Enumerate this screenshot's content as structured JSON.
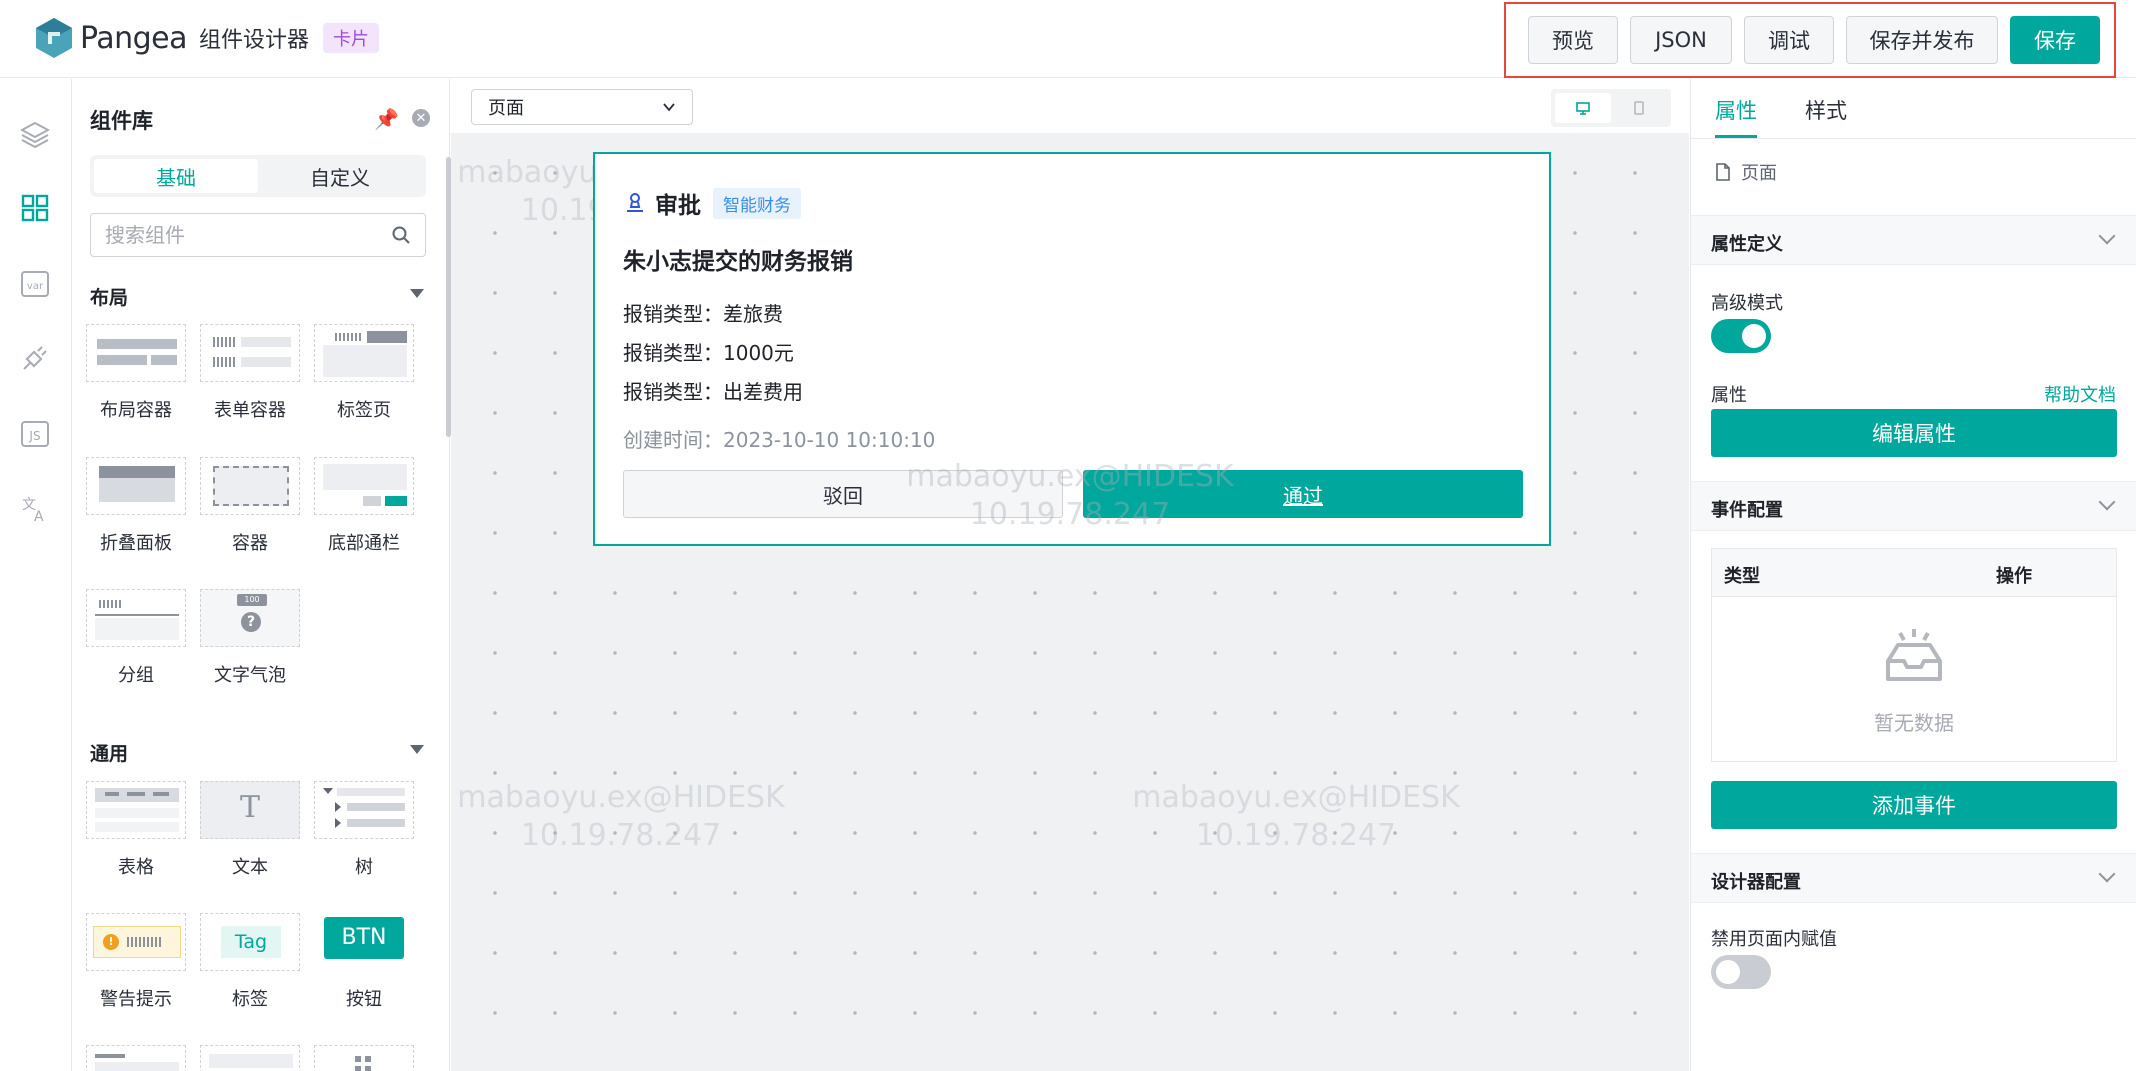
{
  "header": {
    "logo_text": "Pangea",
    "app_title": "组件设计器",
    "badge": "卡片",
    "buttons": {
      "preview": "预览",
      "json": "JSON",
      "debug": "调试",
      "save_publish": "保存并发布",
      "save": "保存"
    }
  },
  "library": {
    "title": "组件库",
    "tabs": [
      "基础",
      "自定义"
    ],
    "active_tab": "基础",
    "search_placeholder": "搜索组件",
    "groups": [
      {
        "name": "布局",
        "items": [
          "布局容器",
          "表单容器",
          "标签页",
          "折叠面板",
          "容器",
          "底部通栏",
          "分组",
          "文字气泡"
        ]
      },
      {
        "name": "通用",
        "items": [
          "表格",
          "文本",
          "树",
          "警告提示",
          "标签",
          "按钮"
        ]
      }
    ],
    "thumb_text": {
      "text": "T",
      "tag": "Tag",
      "btn": "BTN",
      "bubble_num": "100"
    }
  },
  "canvas": {
    "page_select": "页面",
    "watermark_line1": "mabaoyu.ex@HIDESK",
    "watermark_line2": "10.19.78.247"
  },
  "card": {
    "head_title": "审批",
    "tag": "智能财务",
    "title": "朱小志提交的财务报销",
    "lines": [
      "报销类型：差旅费",
      "报销类型：1000元",
      "报销类型：出差费用"
    ],
    "time": "创建时间：2023-10-10 10:10:10",
    "reject": "驳回",
    "approve": "通过"
  },
  "props": {
    "tabs": [
      "属性",
      "样式"
    ],
    "active_tab": "属性",
    "crumb": "页面",
    "sections": {
      "attr_def": "属性定义",
      "events": "事件配置",
      "designer": "设计器配置"
    },
    "advanced_mode": "高级模式",
    "advanced_mode_on": true,
    "attr_label": "属性",
    "help_doc": "帮助文档",
    "edit_attr": "编辑属性",
    "table_type": "类型",
    "table_action": "操作",
    "empty": "暂无数据",
    "add_event": "添加事件",
    "disable_assign": "禁用页面内赋值",
    "disable_assign_on": false
  },
  "colors": {
    "accent": "#00a79c",
    "highlight_border": "#e8453c",
    "badge_bg": "#f1e4fb",
    "badge_text": "#a24bdd"
  }
}
